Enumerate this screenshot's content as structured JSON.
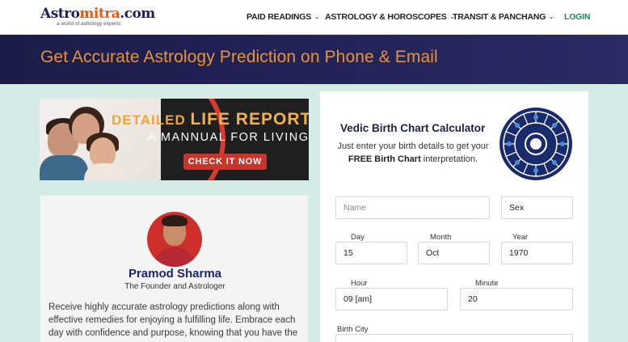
{
  "header": {
    "logo": {
      "part1": "Astro",
      "part2": "mitra",
      "part3": ".com",
      "tagline": "a world of astrology experts"
    },
    "nav": [
      {
        "label": "PAID READINGS",
        "chevron": "chevron-down-icon"
      },
      {
        "label": "ASTROLOGY & HOROSCOPES",
        "chevron": "chevron-down-icon"
      },
      {
        "label": "TRANSIT & PANCHANG",
        "chevron": "chevron-down-icon"
      }
    ],
    "login_label": "LOGIN"
  },
  "banner": {
    "title": "Get Accurate Astrology Prediction on Phone & Email"
  },
  "promo": {
    "line1_a": "DETAILED ",
    "line1_b": "LIFE REPORT",
    "line2": "A MANNUAL FOR LIVING",
    "cta": "CHECK IT NOW"
  },
  "astrologer": {
    "name": "Pramod Sharma",
    "role": "The Founder and Astrologer",
    "description": "Receive highly accurate astrology predictions along with effective remedies for enjoying a fulfilling life. Embrace each day with confidence and purpose, knowing that you have the"
  },
  "calculator": {
    "title": "Vedic Birth Chart Calculator",
    "subtitle_a": "Just enter your birth details to get your ",
    "subtitle_b": "FREE Birth Chart",
    "subtitle_c": " interpretation.",
    "fields": {
      "name_placeholder": "Name",
      "sex_value": "Sex",
      "day_label": "Day",
      "day_value": "15",
      "month_label": "Month",
      "month_value": "Oct",
      "year_label": "Year",
      "year_value": "1970",
      "hour_label": "Hour",
      "hour_value": "09 [am]",
      "minute_label": "Minute",
      "minute_value": "20",
      "birth_city_label": "Birth City"
    }
  },
  "colors": {
    "banner_bg": "#1b1c48",
    "banner_text": "#e8923a",
    "page_bg": "#d6ece6",
    "login": "#1e8a55",
    "cta": "#c8352a",
    "name_color": "#1e2566"
  }
}
